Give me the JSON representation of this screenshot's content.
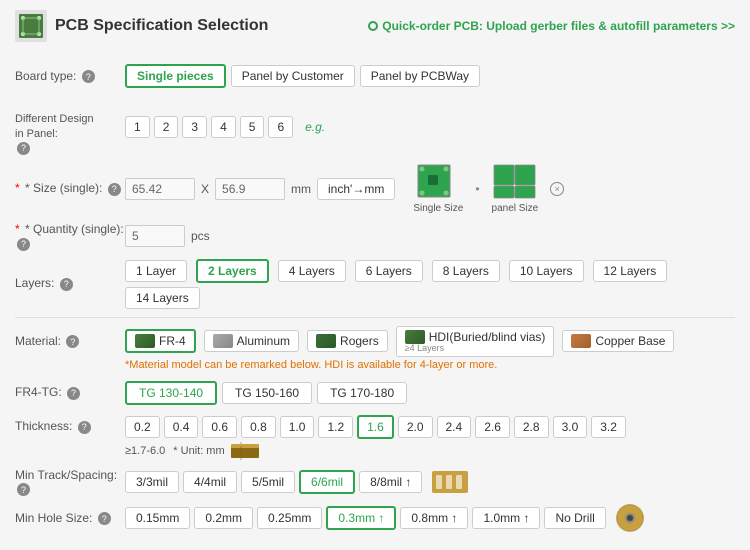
{
  "header": {
    "title": "PCB Specification Selection",
    "quick_order": "Quick-order PCB: Upload gerber files & autofill parameters >>"
  },
  "board_type": {
    "label": "Board type:",
    "options": [
      "Single pieces",
      "Panel by Customer",
      "Panel by PCBWay"
    ],
    "active": "Single pieces"
  },
  "different_design": {
    "label": "Different Design\nin Panel:",
    "numbers": [
      "1",
      "2",
      "3",
      "4",
      "5",
      "6"
    ],
    "eg": "e.g."
  },
  "size": {
    "label": "* Size (single):",
    "width": "65.42",
    "height": "56.9",
    "unit_label": "mm",
    "unit_btn": "inch'→mm",
    "single_size_label": "Single Size",
    "panel_size_label": "panel Size"
  },
  "quantity": {
    "label": "* Quantity (single):",
    "value": "5",
    "unit": "pcs"
  },
  "layers": {
    "label": "Layers:",
    "options": [
      "1 Layer",
      "2 Layers",
      "4 Layers",
      "6 Layers",
      "8 Layers",
      "10 Layers",
      "12 Layers",
      "14 Layers"
    ],
    "active": "2 Layers"
  },
  "material": {
    "label": "Material:",
    "options": [
      {
        "name": "FR-4",
        "icon": "fr4"
      },
      {
        "name": "Aluminum",
        "icon": "aluminum"
      },
      {
        "name": "Rogers",
        "icon": "rogers"
      },
      {
        "name": "HDI(Buried/blind vias)",
        "sub": "≥4 Layers",
        "icon": "hdi"
      },
      {
        "name": "Copper Base",
        "icon": "copper"
      }
    ],
    "active": "FR-4",
    "note": "*Material model can be remarked below. HDI is available for 4-layer or more."
  },
  "fr4_tg": {
    "label": "FR4-TG:",
    "options": [
      "TG 130-140",
      "TG 150-160",
      "TG 170-180"
    ],
    "active": "TG 130-140"
  },
  "thickness": {
    "label": "Thickness:",
    "options": [
      "0.2",
      "0.4",
      "0.6",
      "0.8",
      "1.0",
      "1.2",
      "1.6",
      "2.0",
      "2.4",
      "2.6",
      "2.8",
      "3.0",
      "3.2"
    ],
    "active": "1.6",
    "sub_note": "≥1.7-6.0",
    "unit_note": "* Unit: mm"
  },
  "min_track": {
    "label": "Min Track/Spacing:",
    "options": [
      "3/3mil",
      "4/4mil",
      "5/5mil",
      "6/6mil",
      "8/8mil ↑"
    ],
    "active": "6/6mil"
  },
  "min_hole": {
    "label": "Min Hole Size:",
    "options": [
      "0.15mm",
      "0.2mm",
      "0.25mm",
      "0.3mm ↑",
      "0.8mm ↑",
      "1.0mm ↑",
      "No Drill"
    ],
    "active": "0.3mm ↑"
  }
}
